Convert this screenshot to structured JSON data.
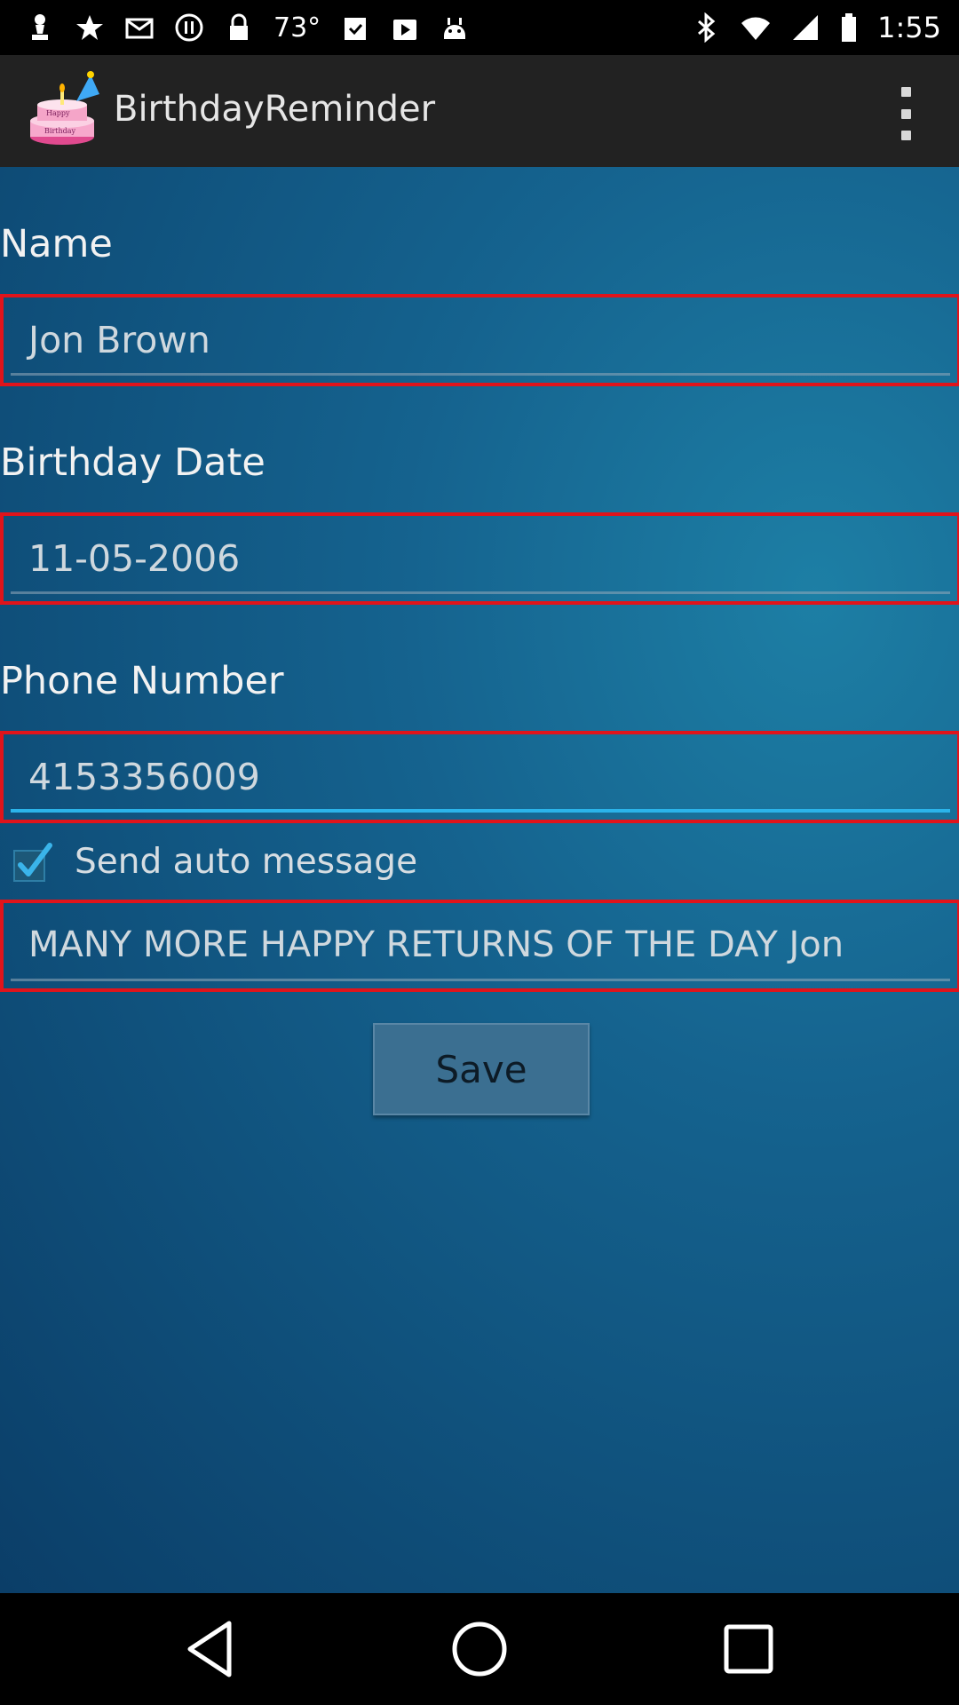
{
  "status_bar": {
    "temperature": "73°",
    "time": "1:55"
  },
  "app": {
    "title": "BirthdayReminder",
    "icon": "birthday-cake-icon",
    "menu_icon": "overflow-menu-icon"
  },
  "form": {
    "name_label": "Name",
    "name_value": "Jon Brown",
    "date_label": "Birthday Date",
    "date_value": "11-05-2006",
    "phone_label": "Phone Number",
    "phone_value": "4153356009",
    "auto_message_checked": true,
    "auto_message_label": "Send auto message",
    "message_value": "MANY MORE HAPPY RETURNS OF THE DAY Jon",
    "save_label": "Save"
  },
  "colors": {
    "field_border": "#e0141b",
    "focus_underline": "#2bb4ea",
    "checkmark": "#33b5e5"
  }
}
